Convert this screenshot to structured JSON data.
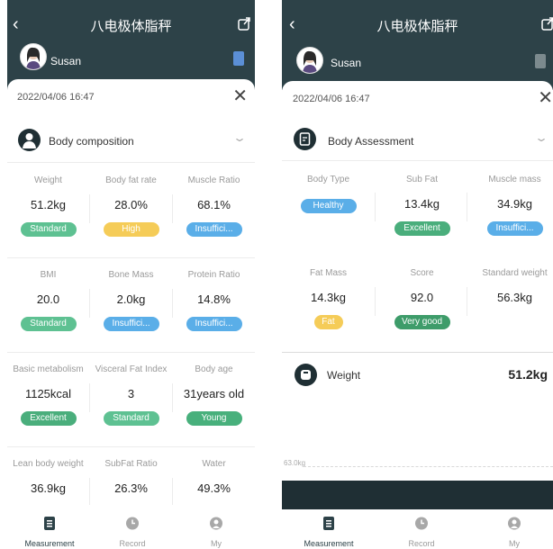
{
  "colors": {
    "header": "#2d4248",
    "standard": "#5ec192",
    "high": "#f5cc58",
    "insufficient": "#5aaee8",
    "excellent": "#4aae7c",
    "young": "#48b07c",
    "healthy": "#5aaee8",
    "fat": "#f5cc58",
    "very_good": "#3e9c6a",
    "tab_active": "#2d4248",
    "tab_inactive": "#9a9a9a"
  },
  "left": {
    "title": "八电极体脂秤",
    "user": "Susan",
    "date": "2022/04/06 16:47",
    "section": "Body composition",
    "metrics": [
      {
        "label": "Weight",
        "value": "51.2kg",
        "badge": "Standard",
        "color": "#5ec192"
      },
      {
        "label": "Body fat rate",
        "value": "28.0%",
        "badge": "High",
        "color": "#f5cc58"
      },
      {
        "label": "Muscle Ratio",
        "value": "68.1%",
        "badge": "Insuffici...",
        "color": "#5aaee8"
      },
      {
        "label": "BMI",
        "value": "20.0",
        "badge": "Standard",
        "color": "#5ec192"
      },
      {
        "label": "Bone Mass",
        "value": "2.0kg",
        "badge": "Insuffici...",
        "color": "#5aaee8"
      },
      {
        "label": "Protein Ratio",
        "value": "14.8%",
        "badge": "Insuffici...",
        "color": "#5aaee8"
      },
      {
        "label": "Basic metabolism",
        "value": "1125kcal",
        "badge": "Excellent",
        "color": "#4aae7c"
      },
      {
        "label": "Visceral Fat Index",
        "value": "3",
        "badge": "Standard",
        "color": "#5ec192"
      },
      {
        "label": "Body age",
        "value": "31years old",
        "badge": "Young",
        "color": "#48b07c"
      },
      {
        "label": "Lean body weight",
        "value": "36.9kg"
      },
      {
        "label": "SubFat Ratio",
        "value": "26.3%"
      },
      {
        "label": "Water",
        "value": "49.3%"
      }
    ],
    "tabs": [
      {
        "label": "Measurement",
        "icon": "document-icon"
      },
      {
        "label": "Record",
        "icon": "clock-icon"
      },
      {
        "label": "My",
        "icon": "person-icon"
      }
    ]
  },
  "right": {
    "title": "八电极体脂秤",
    "user": "Susan",
    "date": "2022/04/06 16:47",
    "section": "Body Assessment",
    "metrics": [
      {
        "label": "Body Type",
        "badge": "Healthy",
        "color": "#5aaee8"
      },
      {
        "label": "Sub Fat",
        "value": "13.4kg",
        "badge": "Excellent",
        "color": "#4aae7c"
      },
      {
        "label": "Muscle mass",
        "value": "34.9kg",
        "badge": "Insuffici...",
        "color": "#5aaee8"
      },
      {
        "label": "Fat Mass",
        "value": "14.3kg",
        "badge": "Fat",
        "color": "#f5cc58"
      },
      {
        "label": "Score",
        "value": "92.0",
        "badge": "Very good",
        "color": "#3e9c6a"
      },
      {
        "label": "Standard weight",
        "value": "56.3kg"
      }
    ],
    "weight_label": "Weight",
    "weight_value": "51.2kg",
    "graph_axis": "63.0kg",
    "tabs": [
      {
        "label": "Measurement",
        "icon": "document-icon"
      },
      {
        "label": "Record",
        "icon": "clock-icon"
      },
      {
        "label": "My",
        "icon": "person-icon"
      }
    ]
  }
}
